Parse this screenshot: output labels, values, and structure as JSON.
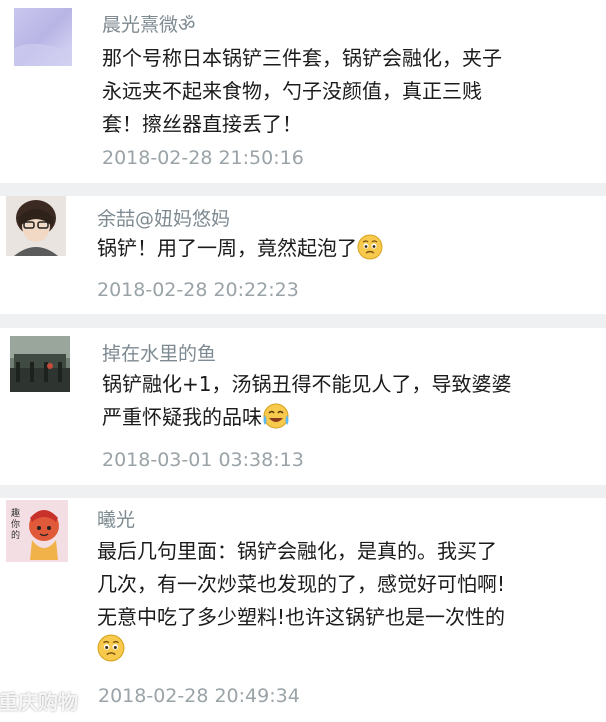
{
  "comments": [
    {
      "user": "晨光熹微ॐ",
      "lines": [
        "那个号称日本锅铲三件套，锅铲会融化，夹子",
        "永远夹不起来食物，勺子没颜值，真正三贱",
        "套！擦丝器直接丢了！"
      ],
      "time": "2018-02-28 21:50:16"
    },
    {
      "user": "余喆@妞妈悠妈",
      "lines": [
        "锅铲！用了一周，竟然起泡了"
      ],
      "time": "2018-02-28 20:22:23",
      "emoji": "worried-face-emoji"
    },
    {
      "user": "掉在水里的鱼",
      "lines": [
        "锅铲融化+1，汤锅丑得不能见人了，导致婆婆",
        "严重怀疑我的品味"
      ],
      "time": "2018-03-01 03:38:13",
      "emoji": "crying-laughing-emoji"
    },
    {
      "user": "曦光",
      "lines": [
        "最后几句里面：锅铲会融化，是真的。我买了",
        "几次，有一次炒菜也发现的了，感觉好可怕啊!",
        "无意中吃了多少塑料!也许这锅铲也是一次性的"
      ],
      "time": "2018-02-28 20:49:34",
      "emoji": "worried-face-emoji",
      "avatar_text": "趣\n你\n的"
    }
  ],
  "watermark": "重庆购物",
  "colors": {
    "name": "#7e8a91",
    "text": "#1b1b1b",
    "time": "#9aa3a8",
    "separator": "#eef0f1"
  }
}
